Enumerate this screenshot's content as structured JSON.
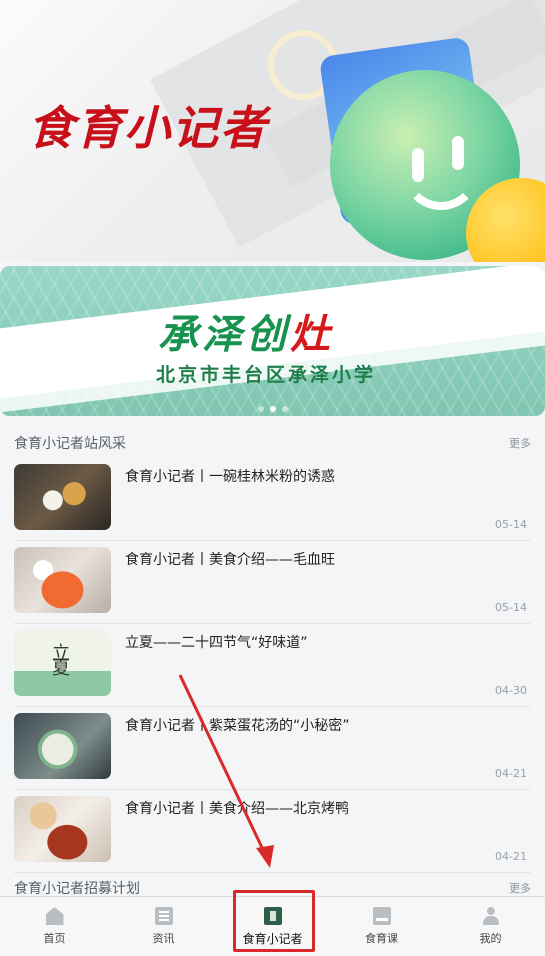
{
  "hero": {
    "title": "食育小记者"
  },
  "slider": {
    "title_green": "承泽创",
    "title_red": "灶",
    "subtitle": "北京市丰台区承泽小学",
    "dots": [
      false,
      true,
      false
    ]
  },
  "section1": {
    "title": "食育小记者站风采",
    "more": "更多",
    "items": [
      {
        "title": "食育小记者丨一碗桂林米粉的诱惑",
        "date": "05-14",
        "thumb": "guilin-rice-noodle-photo"
      },
      {
        "title": "食育小记者丨美食介绍——毛血旺",
        "date": "05-14",
        "thumb": "maoxuewang-photo"
      },
      {
        "title": "立夏——二十四节气“好味道”",
        "date": "04-30",
        "thumb": "lixia-poster",
        "thumb_text": "立夏"
      },
      {
        "title": "食育小记者丨紫菜蛋花汤的“小秘密”",
        "date": "04-21",
        "thumb": "seaweed-egg-soup-photo"
      },
      {
        "title": "食育小记者丨美食介绍——北京烤鸭",
        "date": "04-21",
        "thumb": "beijing-roast-duck-photo"
      }
    ]
  },
  "section2": {
    "title": "食育小记者招募计划",
    "more": "更多"
  },
  "tabbar": {
    "tabs": [
      {
        "label": "首页",
        "icon": "home-icon"
      },
      {
        "label": "资讯",
        "icon": "news-icon"
      },
      {
        "label": "食育小记者",
        "icon": "reporter-icon",
        "active": true
      },
      {
        "label": "食育课",
        "icon": "course-icon"
      },
      {
        "label": "我的",
        "icon": "profile-icon"
      }
    ]
  },
  "annotation": {
    "color": "#d9292b"
  }
}
